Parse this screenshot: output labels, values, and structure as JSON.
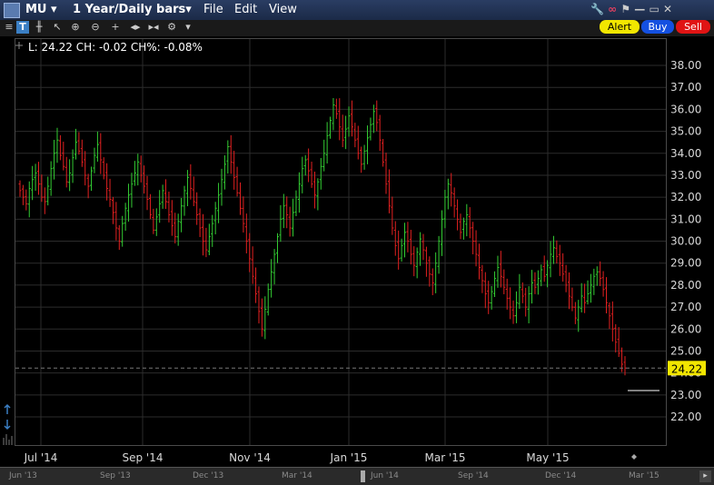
{
  "window": {
    "symbol": "MU",
    "period": "1 Year/Daily bars",
    "menu": [
      "File",
      "Edit",
      "View"
    ]
  },
  "buttons": {
    "alert": "Alert",
    "buy": "Buy",
    "sell": "Sell"
  },
  "chart_data": {
    "type": "ohlc",
    "info_line": "L: 24.22 CH: -0.02 CH%: -0.08%",
    "last_price_label": "24.22",
    "ylim": [
      21.5,
      38.6
    ],
    "y_ticks": [
      "22.00",
      "23.00",
      "24.00",
      "25.00",
      "26.00",
      "27.00",
      "28.00",
      "29.00",
      "30.00",
      "31.00",
      "32.00",
      "33.00",
      "34.00",
      "35.00",
      "36.00",
      "37.00",
      "38.00"
    ],
    "x_ticks": [
      "Jul '14",
      "Sep '14",
      "Nov '14",
      "Jan '15",
      "Mar '15",
      "May '15"
    ],
    "grid": true,
    "up_color": "#33cc33",
    "down_color": "#e02020",
    "closes": [
      32.3,
      32.0,
      31.7,
      32.4,
      32.8,
      33.1,
      32.6,
      32.0,
      31.8,
      32.5,
      33.3,
      34.0,
      34.6,
      33.9,
      33.4,
      32.7,
      33.1,
      33.8,
      34.5,
      34.1,
      33.6,
      33.0,
      32.5,
      33.2,
      33.9,
      34.4,
      33.7,
      33.0,
      32.4,
      31.9,
      31.3,
      30.6,
      30.0,
      30.8,
      31.5,
      32.1,
      32.6,
      33.1,
      33.6,
      33.0,
      32.5,
      31.9,
      31.2,
      30.5,
      31.1,
      31.7,
      32.3,
      31.8,
      31.2,
      30.7,
      30.2,
      30.9,
      31.6,
      32.3,
      32.9,
      32.4,
      31.8,
      31.2,
      30.6,
      30.0,
      29.6,
      30.2,
      30.8,
      31.5,
      32.1,
      32.8,
      33.5,
      34.3,
      33.6,
      32.9,
      32.2,
      31.5,
      30.8,
      30.0,
      29.2,
      28.4,
      27.6,
      26.8,
      26.0,
      26.9,
      27.8,
      28.6,
      29.4,
      30.2,
      31.0,
      31.6,
      31.2,
      30.6,
      31.3,
      32.0,
      32.6,
      33.3,
      33.7,
      33.2,
      32.6,
      32.1,
      32.7,
      33.4,
      34.0,
      34.8,
      35.5,
      36.2,
      35.8,
      35.2,
      34.6,
      35.1,
      35.7,
      35.2,
      34.6,
      34.0,
      33.5,
      34.1,
      34.7,
      35.3,
      35.9,
      35.4,
      34.6,
      33.6,
      32.6,
      31.6,
      30.6,
      29.8,
      29.2,
      29.8,
      30.4,
      30.0,
      29.4,
      28.9,
      29.5,
      30.1,
      29.6,
      29.0,
      28.5,
      28.1,
      29.0,
      30.0,
      31.0,
      32.0,
      32.6,
      32.2,
      31.6,
      31.0,
      30.4,
      30.9,
      31.2,
      30.6,
      30.0,
      29.4,
      28.8,
      28.2,
      27.6,
      27.2,
      27.7,
      28.3,
      28.8,
      28.4,
      27.9,
      27.4,
      27.0,
      26.6,
      27.2,
      27.9,
      27.5,
      27.0,
      27.6,
      28.1,
      27.9,
      28.3,
      28.7,
      28.4,
      28.9,
      29.4,
      29.7,
      29.3,
      29.0,
      28.5,
      28.0,
      27.5,
      27.0,
      26.5,
      27.0,
      27.5,
      27.2,
      27.6,
      28.0,
      28.4,
      28.6,
      28.3,
      27.8,
      27.2,
      26.6,
      26.0,
      25.4,
      24.9,
      24.4,
      24.22
    ]
  }
}
